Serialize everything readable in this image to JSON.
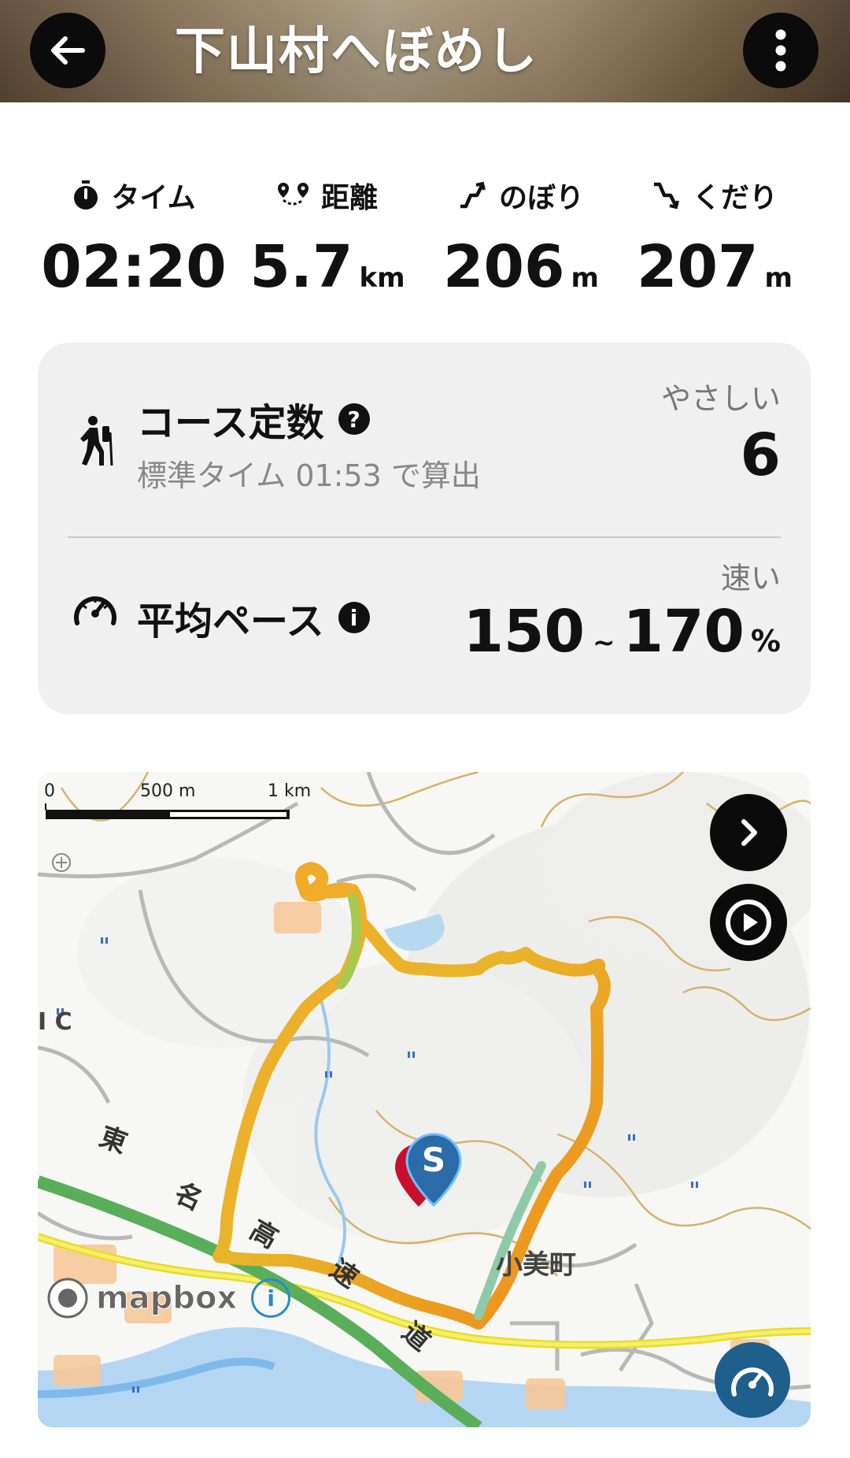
{
  "header": {
    "title": "下山村へぼめし",
    "back_icon": "arrow-left-icon",
    "menu_icon": "more-vertical-icon"
  },
  "stats": [
    {
      "label": "タイム",
      "value": "02:20",
      "unit": "",
      "icon": "stopwatch-icon"
    },
    {
      "label": "距離",
      "value": "5.7",
      "unit": "km",
      "icon": "route-pin-icon"
    },
    {
      "label": "のぼり",
      "value": "206",
      "unit": "m",
      "icon": "ascent-icon"
    },
    {
      "label": "くだり",
      "value": "207",
      "unit": "m",
      "icon": "descent-icon"
    }
  ],
  "course": {
    "title": "コース定数",
    "help": "?",
    "subtitle": "標準タイム 01:53 で算出",
    "rating_label": "やさしい",
    "value": "6"
  },
  "pace": {
    "title": "平均ペース",
    "info": "i",
    "rating_label": "速い",
    "min": "150",
    "tilde": "~",
    "max": "170",
    "unit": "%"
  },
  "map": {
    "scale": {
      "zero": "0",
      "half": "500 m",
      "full": "1 km"
    },
    "labels": {
      "town": "小美町",
      "ic": "I C",
      "road1": "東",
      "road2": "名",
      "road3": "高",
      "road4": "速",
      "road5": "道"
    },
    "start_marker": "S",
    "attribution": "mapbox",
    "info_icon": "i"
  },
  "colors": {
    "accent_blue": "#1f5f8b",
    "track_orange": "#f0a020",
    "track_green": "#9ccc50",
    "highway_green": "#4caf50",
    "road_yellow": "#f2ea3a"
  }
}
